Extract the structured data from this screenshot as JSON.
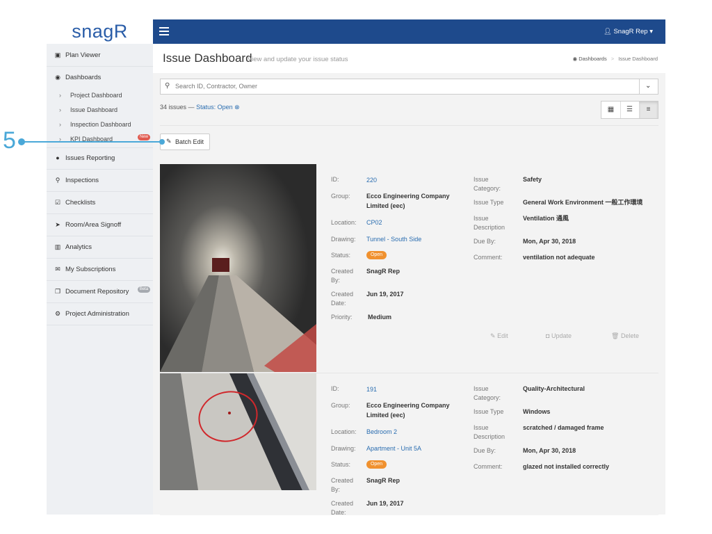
{
  "app": {
    "logo": "snagR"
  },
  "topbar": {
    "user": "SnagR Rep"
  },
  "sidebar": {
    "items": [
      {
        "label": "Plan Viewer",
        "icon": "image-icon",
        "glyph": "▣"
      },
      {
        "label": "Dashboards",
        "icon": "dashboard-icon",
        "glyph": "◉"
      },
      {
        "label": "Issues Reporting",
        "icon": "map-marker-icon",
        "glyph": "●"
      },
      {
        "label": "Inspections",
        "icon": "search-icon",
        "glyph": "⚲"
      },
      {
        "label": "Checklists",
        "icon": "checkbox-icon",
        "glyph": "☑"
      },
      {
        "label": "Room/Area Signoff",
        "icon": "location-arrow-icon",
        "glyph": "➤"
      },
      {
        "label": "Analytics",
        "icon": "bar-chart-icon",
        "glyph": "▥"
      },
      {
        "label": "My Subscriptions",
        "icon": "envelope-icon",
        "glyph": "✉"
      },
      {
        "label": "Document Repository",
        "icon": "documents-icon",
        "glyph": "❐"
      },
      {
        "label": "Project Administration",
        "icon": "cogs-icon",
        "glyph": "⚙"
      }
    ],
    "subitems": [
      "Project Dashboard",
      "Issue Dashboard",
      "Inspection Dashboard",
      "KPI Dashboard"
    ],
    "badge_new": "New",
    "badge_beta": "Beta"
  },
  "header": {
    "title": "Issue Dashboard",
    "subtitle": "View and update your issue status",
    "breadcrumb_home": "Dashboards",
    "breadcrumb_current": "Issue Dashboard"
  },
  "search": {
    "placeholder": "Search ID, Contractor, Owner"
  },
  "summary": {
    "count": "34 issues",
    "dash": "—",
    "status": "Status: Open"
  },
  "batch_edit": "Batch Edit",
  "annotation": {
    "number": "5"
  },
  "labels": {
    "id": "ID:",
    "group": "Group:",
    "location": "Location:",
    "drawing": "Drawing:",
    "status": "Status:",
    "created_by": "Created By:",
    "created_date": "Created Date:",
    "priority": "Priority:",
    "issue_category": "Issue Category:",
    "issue_type": "Issue Type",
    "issue_description": "Issue Description",
    "due_by": "Due By:",
    "comment": "Comment:"
  },
  "actions": {
    "edit": "Edit",
    "update": "Update",
    "delete": "Delete"
  },
  "issues": [
    {
      "id": "220",
      "group": "Ecco Engineering Company Limited  (eec)",
      "location": "CP02",
      "drawing": "Tunnel - South Side",
      "status": "Open",
      "created_by": "SnagR Rep",
      "created_date": "Jun 19, 2017",
      "priority": "Medium",
      "category": "Safety",
      "type": "General Work Environment 一般工作環境",
      "description": "Ventilation 通風",
      "due_by": "Mon, Apr 30, 2018",
      "comment": "ventilation not adequate"
    },
    {
      "id": "191",
      "group": "Ecco Engineering Company Limited  (eec)",
      "location": "Bedroom 2",
      "drawing": "Apartment - Unit 5A",
      "status": "Open",
      "created_by": "SnagR Rep",
      "created_date": "Jun 19, 2017",
      "category": "Quality-Architectural",
      "type": "Windows",
      "description": "scratched / damaged frame",
      "due_by": "Mon, Apr 30, 2018",
      "comment": "glazed not installed correctly"
    }
  ]
}
